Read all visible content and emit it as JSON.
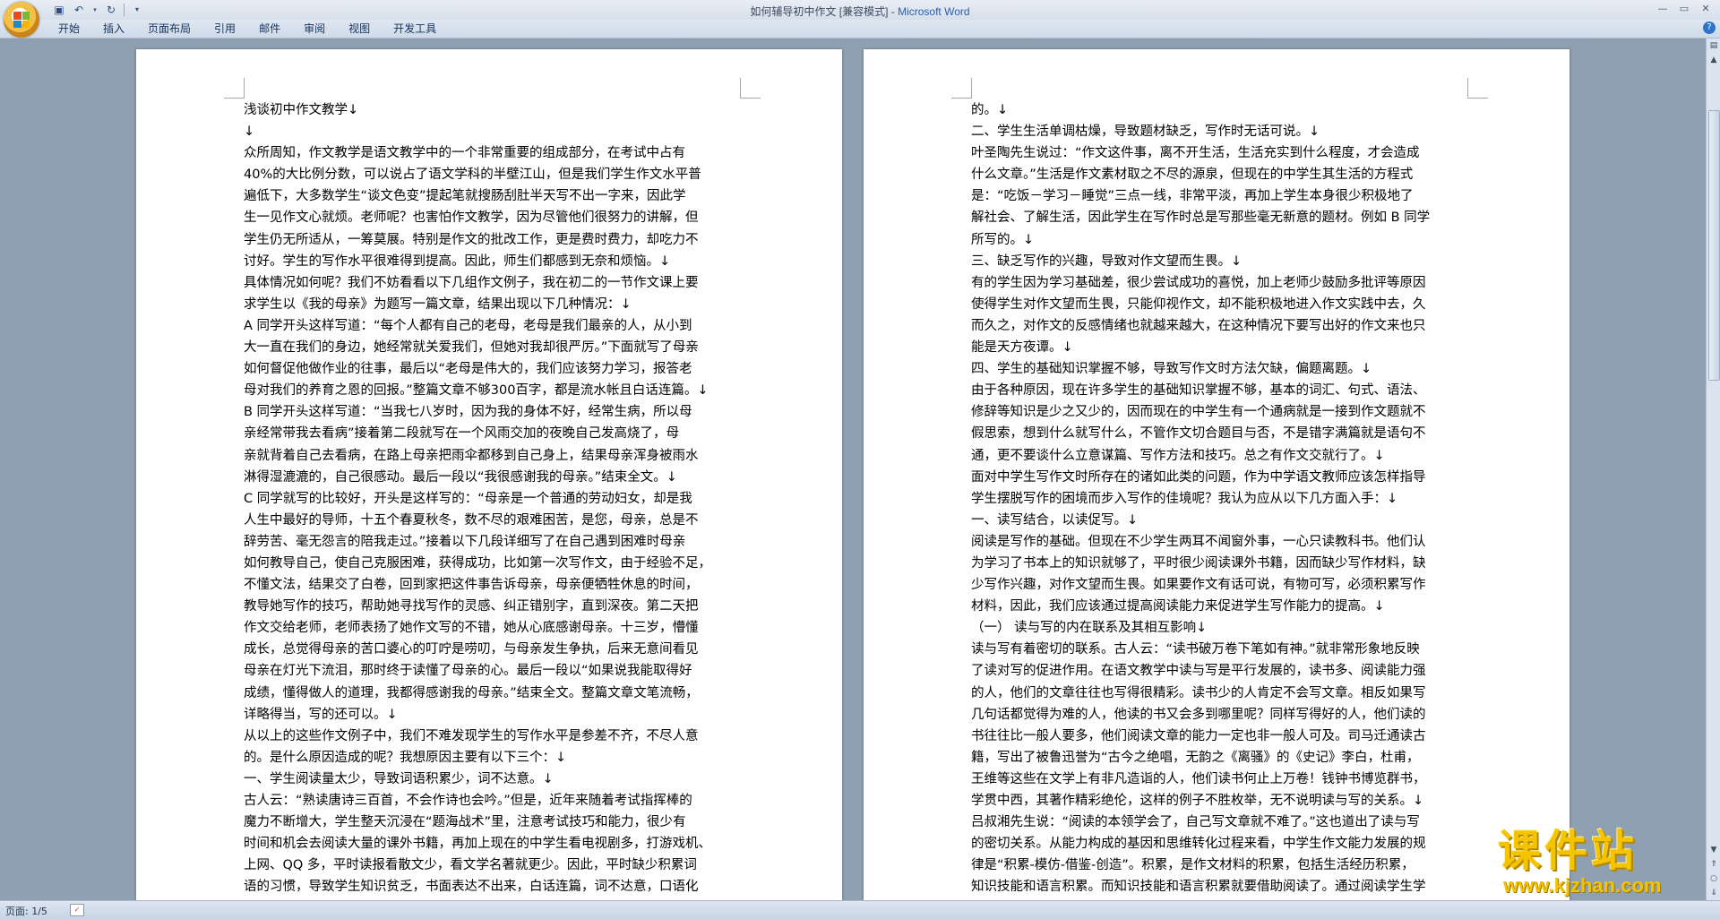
{
  "window": {
    "title_doc": "如何辅导初中作文 [兼容模式] - ",
    "title_app": "Microsoft Word"
  },
  "ribbon": {
    "tabs": [
      "开始",
      "插入",
      "页面布局",
      "引用",
      "邮件",
      "审阅",
      "视图",
      "开发工具"
    ]
  },
  "left_page": {
    "lines": [
      "浅谈初中作文教学↓",
      "↓",
      "众所周知，作文教学是语文教学中的一个非常重要的组成部分，在考试中占有",
      "40%的大比例分数，可以说占了语文学科的半壁江山，但是我们学生作文水平普",
      "遍低下，大多数学生“谈文色变”提起笔就搜肠刮肚半天写不出一字来，因此学",
      "生一见作文心就烦。老师呢？也害怕作文教学，因为尽管他们很努力的讲解，但",
      "学生仍无所适从，一筹莫展。特别是作文的批改工作，更是费时费力，却吃力不",
      "讨好。学生的写作水平很难得到提高。因此，师生们都感到无奈和烦恼。↓",
      "具体情况如何呢？我们不妨看看以下几组作文例子，我在初二的一节作文课上要",
      "求学生以《我的母亲》为题写一篇文章，结果出现以下几种情况：↓",
      "A 同学开头这样写道：“每个人都有自己的老母，老母是我们最亲的人，从小到",
      "大一直在我们的身边，她经常就关爱我们，但她对我却很严厉。”下面就写了母亲",
      "如何督促他做作业的往事，最后以“老母是伟大的，我们应该努力学习，报答老",
      "母对我们的养育之恩的回报。”整篇文章不够300百字，都是流水帐且白话连篇。↓",
      "B 同学开头这样写道：“当我七八岁时，因为我的身体不好，经常生病，所以母",
      "亲经常带我去看病”接着第二段就写在一个风雨交加的夜晚自己发高烧了，母",
      "亲就背着自己去看病，在路上母亲把雨伞都移到自己身上，结果母亲浑身被雨水",
      "淋得湿漉漉的，自己很感动。最后一段以“我很感谢我的母亲。”结束全文。↓",
      "C 同学就写的比较好，开头是这样写的：“母亲是一个普通的劳动妇女，却是我",
      "人生中最好的导师，十五个春夏秋冬，数不尽的艰难困苦，是您，母亲，总是不",
      "辞劳苦、毫无怨言的陪我走过。”接着以下几段详细写了在自己遇到困难时母亲",
      "如何教导自己，使自己克服困难，获得成功，比如第一次写作文，由于经验不足，",
      "不懂文法，结果交了白卷，回到家把这件事告诉母亲，母亲便牺牲休息的时间，",
      "教导她写作的技巧，帮助她寻找写作的灵感、纠正错别字，直到深夜。第二天把",
      "作文交给老师，老师表扬了她作文写的不错，她从心底感谢母亲。十三岁，懵懂",
      "成长，总觉得母亲的苦口婆心的叮咛是唠叨，与母亲发生争执，后来无意间看见",
      "母亲在灯光下流泪，那时终于读懂了母亲的心。最后一段以“如果说我能取得好",
      "成绩，懂得做人的道理，我都得感谢我的母亲。”结束全文。整篇文章文笔流畅，",
      "详略得当，写的还可以。↓",
      "从以上的这些作文例子中，我们不难发现学生的写作水平是参差不齐，不尽人意",
      "的。是什么原因造成的呢？我想原因主要有以下三个：↓",
      "一、学生阅读量太少，导致词语积累少，词不达意。↓",
      "古人云：“熟读唐诗三百首，不会作诗也会吟。”但是，近年来随着考试指挥棒的",
      "魔力不断增大，学生整天沉浸在“题海战术”里，注意考试技巧和能力，很少有",
      "时间和机会去阅读大量的课外书籍，再加上现在的中学生看电视剧多，打游戏机、",
      "上网、QQ 多，平时读报看散文少，看文学名著就更少。因此，平时缺少积累词",
      "语的习惯，导致学生知识贫乏，书面表达不出来，白话连篇，词不达意，口语化"
    ]
  },
  "right_page": {
    "lines": [
      "的。↓",
      "二、学生生活单调枯燥，导致题材缺乏，写作时无话可说。↓",
      "叶圣陶先生说过：“作文这件事，离不开生活，生活充实到什么程度，才会造成",
      "什么文章。”生活是作文素材取之不尽的源泉，但现在的中学生其生活的方程式",
      "是：“吃饭－学习－睡觉”三点一线，非常平淡，再加上学生本身很少积极地了",
      "解社会、了解生活，因此学生在写作时总是写那些毫无新意的题材。例如 B 同学",
      "所写的。↓",
      "三、缺乏写作的兴趣，导致对作文望而生畏。↓",
      "有的学生因为学习基础差，很少尝试成功的喜悦，加上老师少鼓励多批评等原因",
      "使得学生对作文望而生畏，只能仰视作文，却不能积极地进入作文实践中去，久",
      "而久之，对作文的反感情绪也就越来越大，在这种情况下要写出好的作文来也只",
      "能是天方夜谭。↓",
      "四、学生的基础知识掌握不够，导致写作文时方法欠缺，偏题离题。↓",
      "由于各种原因，现在许多学生的基础知识掌握不够，基本的词汇、句式、语法、",
      "修辞等知识是少之又少的，因而现在的中学生有一个通病就是一接到作文题就不",
      "假思索，想到什么就写什么，不管作文切合题目与否，不是错字满篇就是语句不",
      "通，更不要谈什么立意谋篇、写作方法和技巧。总之有作文交就行了。↓",
      "面对中学生写作文时所存在的诸如此类的问题，作为中学语文教师应该怎样指导",
      "学生摆脱写作的困境而步入写作的佳境呢？我认为应从以下几方面入手：↓",
      "一、读写结合，以读促写。↓",
      "阅读是写作的基础。但现在不少学生两耳不闻窗外事，一心只读教科书。他们认",
      "为学习了书本上的知识就够了，平时很少阅读课外书籍，因而缺少写作材料，缺",
      "少写作兴趣，对作文望而生畏。如果要作文有话可说，有物可写，必须积累写作",
      "材料，因此，我们应该通过提高阅读能力来促进学生写作能力的提高。↓",
      "（一）  读与写的内在联系及其相互影响↓",
      "读与写有着密切的联系。古人云：“读书破万卷下笔如有神。”就非常形象地反映",
      "了读对写的促进作用。在语文教学中读与写是平行发展的，读书多、阅读能力强",
      "的人，他们的文章往往也写得很精彩。读书少的人肯定不会写文章。相反如果写",
      "几句话都觉得为难的人，他读的书又会多到哪里呢？同样写得好的人，他们读的",
      "书往往比一般人要多，他们阅读文章的能力一定也非一般人可及。司马迁通读古",
      "籍，写出了被鲁迅誉为“古今之绝唱，无韵之《离骚》的《史记》李白，杜甫，",
      "王维等这些在文学上有非凡造诣的人，他们读书何止上万卷！钱钟书博览群书，",
      "学贯中西，其著作精彩绝伦，这样的例子不胜枚举，无不说明读与写的关系。↓",
      "吕叔湘先生说：“阅读的本领学会了，自己写文章就不难了。”这也道出了读与写",
      "的密切关系。从能力构成的基因和思维转化过程来看，中学生作文能力发展的规",
      "律是“积累-模仿-借鉴-创造”。积累，是作文材料的积累，包括生活经历积累，",
      "知识技能和语言积累。而知识技能和语言积累就要借助阅读了。通过阅读学生学"
    ]
  },
  "status": {
    "page": "页面: 1/5"
  },
  "watermark": {
    "title": "课件站",
    "url": "www.kjzhan.com"
  }
}
